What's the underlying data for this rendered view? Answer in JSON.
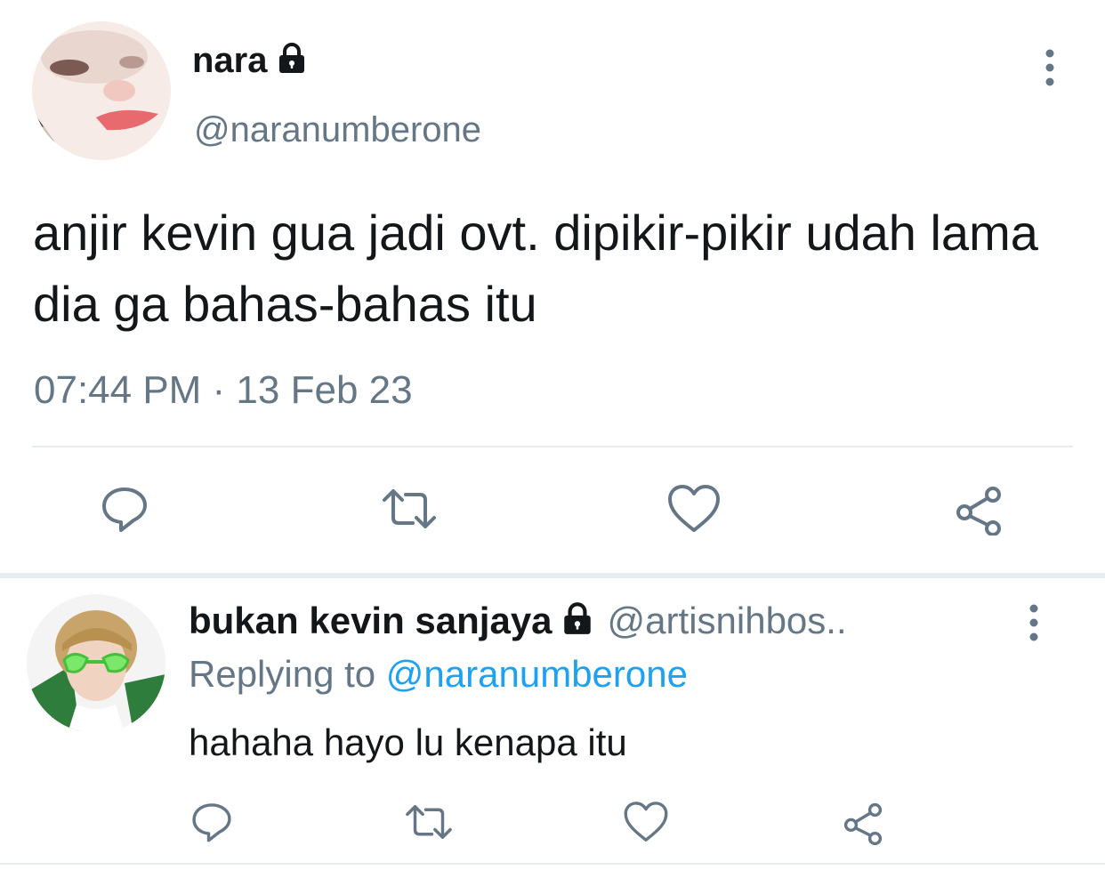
{
  "tweet": {
    "author_name": "nara",
    "author_handle": "@naranumberone",
    "text": "anjir kevin gua jadi ovt. dipikir-pikir udah lama dia ga bahas-bahas itu",
    "timestamp": "07:44 PM · 13 Feb 23",
    "actions": [
      "reply-icon",
      "retweet-icon",
      "like-icon",
      "share-icon"
    ]
  },
  "reply": {
    "author_name": "bukan kevin sanjaya",
    "author_handle": "@artisnihbos..",
    "replying_prefix": "Replying to",
    "replying_mention": "@naranumberone",
    "text": "hahaha hayo lu kenapa itu",
    "actions": [
      "reply-icon",
      "retweet-icon",
      "like-icon",
      "share-icon"
    ]
  },
  "colors": {
    "text": "#14171a",
    "secondary": "#657786",
    "mention": "#1da1f2",
    "divider": "#e6ecf0",
    "icon": "#657786"
  }
}
